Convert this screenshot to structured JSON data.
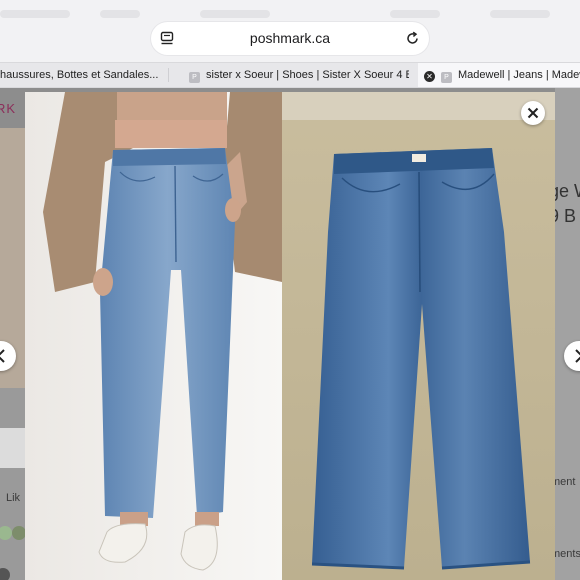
{
  "browser": {
    "url": "poshmark.ca",
    "tabs": [
      {
        "title": "haussures, Bottes et Sandales...",
        "favicon": ""
      },
      {
        "title": "sister x Soeur | Shoes | Sister X Soeur 4 B...",
        "favicon": "P"
      },
      {
        "title": "Madewell | Jeans | Madewell",
        "favicon": "P",
        "active": true
      }
    ],
    "icons": {
      "tabs_overview": "tabs-overview-icon",
      "reload": "reload-icon",
      "close_tab": "close-tab-icon"
    }
  },
  "page": {
    "logo_partial": "RK",
    "left_sidebar": {
      "like_label": "Lik"
    },
    "right_sidebar": {
      "title_fragment_1": "ge W",
      "title_fragment_2": "9 B",
      "comments_fragment_1": "ment",
      "comments_fragment_2": "ments"
    }
  },
  "lightbox": {
    "images": [
      {
        "alt": "Model wearing Madewell high-rise light wash straight crop jeans with white loafers"
      },
      {
        "alt": "Madewell high-rise wide leg jeans laid flat on carpet"
      }
    ],
    "controls": {
      "close": "close-icon",
      "previous": "chevron-left-icon",
      "next": "chevron-right-icon"
    }
  },
  "colors": {
    "brand": "#8c2e5a",
    "denim_light": "#6f93bd",
    "denim_dark": "#3f6a9e"
  }
}
